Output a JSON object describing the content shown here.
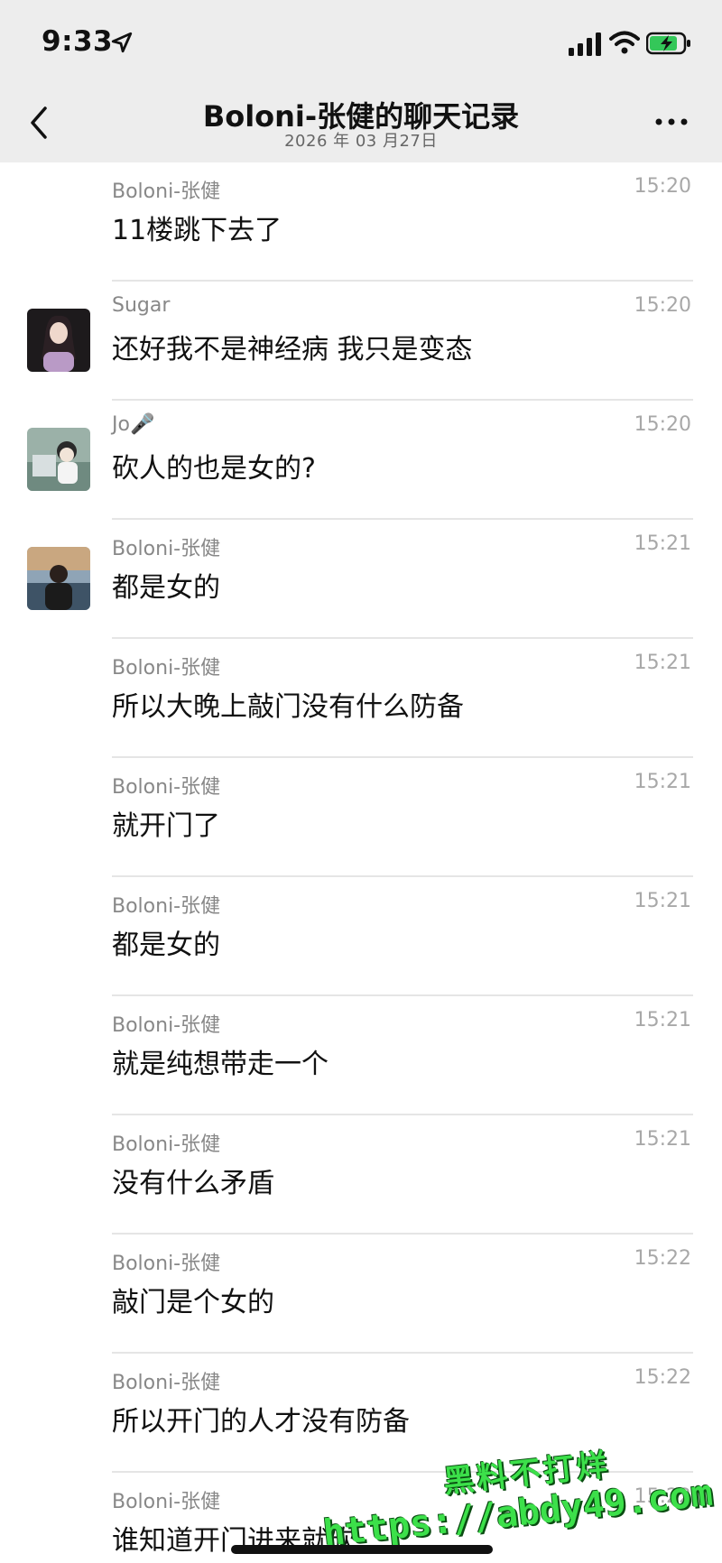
{
  "status_bar": {
    "time": "9:33",
    "icons": [
      "location-arrow-icon",
      "cellular-signal-icon",
      "wifi-icon",
      "battery-charging-icon"
    ]
  },
  "nav": {
    "title": "Boloni-张健的聊天记录",
    "subtitle": "2026 年 03 月27日",
    "back_icon": "chevron-left-icon",
    "more_icon": "ellipsis-icon"
  },
  "messages": [
    {
      "sender": "Boloni-张健",
      "time": "15:20",
      "text": "11楼跳下去了"
    },
    {
      "sender": "Sugar",
      "time": "15:20",
      "text": "还好我不是神经病 我只是变态"
    },
    {
      "sender": "Jo",
      "sender_emoji": "🎤",
      "time": "15:20",
      "text": "砍人的也是女的?"
    },
    {
      "sender": "Boloni-张健",
      "time": "15:21",
      "text": "都是女的"
    },
    {
      "sender": "Boloni-张健",
      "time": "15:21",
      "text": "所以大晚上敲门没有什么防备"
    },
    {
      "sender": "Boloni-张健",
      "time": "15:21",
      "text": "就开门了"
    },
    {
      "sender": "Boloni-张健",
      "time": "15:21",
      "text": "都是女的"
    },
    {
      "sender": "Boloni-张健",
      "time": "15:21",
      "text": "就是纯想带走一个"
    },
    {
      "sender": "Boloni-张健",
      "time": "15:21",
      "text": "没有什么矛盾"
    },
    {
      "sender": "Boloni-张健",
      "time": "15:22",
      "text": "敲门是个女的"
    },
    {
      "sender": "Boloni-张健",
      "time": "15:22",
      "text": "所以开门的人才没有防备"
    },
    {
      "sender": "Boloni-张健",
      "time": "15:22",
      "text": "谁知道开门进来就砍"
    }
  ],
  "watermark": {
    "line1": "黑料不打烊",
    "line2": "https://abdy49.com"
  },
  "colors": {
    "header_bg": "#ededed",
    "watermark_green": "#3ce04a"
  }
}
